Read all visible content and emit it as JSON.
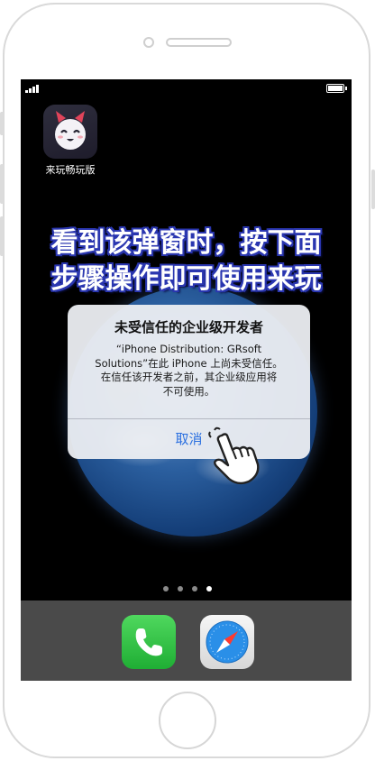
{
  "app_icon": {
    "label": "来玩畅玩版",
    "icon": "smiling-mascot-icon"
  },
  "headline": {
    "line1": "看到该弹窗时，按下面",
    "line2": "步骤操作即可使用来玩"
  },
  "alert": {
    "title": "未受信任的企业级开发者",
    "message_line1": "“iPhone Distribution: GRsoft",
    "message_line2": "Solutions”在此 iPhone 上尚未受信任。",
    "message_line3": "在信任该开发者之前，其企业级应用将",
    "message_line4": "不可使用。",
    "cancel_label": "取消"
  },
  "page_indicator": {
    "count": 4,
    "active_index": 3
  },
  "dock": {
    "icons": [
      "phone-icon",
      "safari-icon"
    ]
  },
  "colors": {
    "headline_outline": "#2a36b0",
    "alert_button": "#2a6fe0",
    "phone_green": "#38c94b"
  }
}
